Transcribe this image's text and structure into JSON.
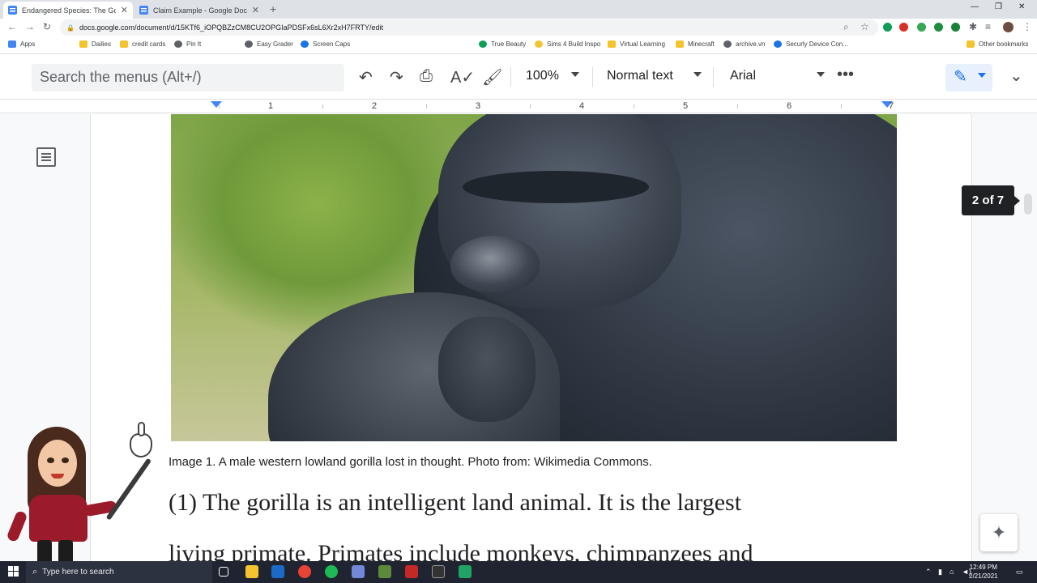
{
  "browser": {
    "tabs": [
      {
        "title": "Endangered Species: The Gorilla",
        "active": true
      },
      {
        "title": "Claim Example - Google Docs",
        "active": false
      }
    ],
    "url": "docs.google.com/document/d/15KTf6_iOPQBZzCM8CU2OPGIaPDSFx6sL6Xr2xH7FRTY/edit",
    "bookmarks": [
      "Apps",
      "Dailies",
      "credit cards",
      "Pin It",
      "Easy Grader",
      "Screen Caps",
      "True Beauty",
      "Sims 4 Build Inspo",
      "Virtual Learning",
      "Minecraft",
      "archive.vn",
      "Securly Device Con...",
      "Other bookmarks"
    ]
  },
  "toolbar": {
    "menu_search_placeholder": "Search the menus (Alt+/)",
    "zoom": "100%",
    "style": "Normal text",
    "font": "Arial"
  },
  "ruler": {
    "numbers": [
      "1",
      "2",
      "3",
      "4",
      "5",
      "6",
      "7"
    ]
  },
  "document": {
    "caption": "Image 1. A male western lowland gorilla lost in thought. Photo from: Wikimedia Commons.",
    "paragraph_line1": "(1) The gorilla is an intelligent land animal. It is the largest",
    "paragraph_line2": "living primate. Primates include monkeys, chimpanzees and",
    "page_indicator": "2 of 7"
  },
  "taskbar": {
    "search_placeholder": "Type here to search",
    "time": "12:49 PM",
    "date": "2/21/2021"
  },
  "colors": {
    "accent": "#1a73e8",
    "taskbar": "#1f2430"
  }
}
